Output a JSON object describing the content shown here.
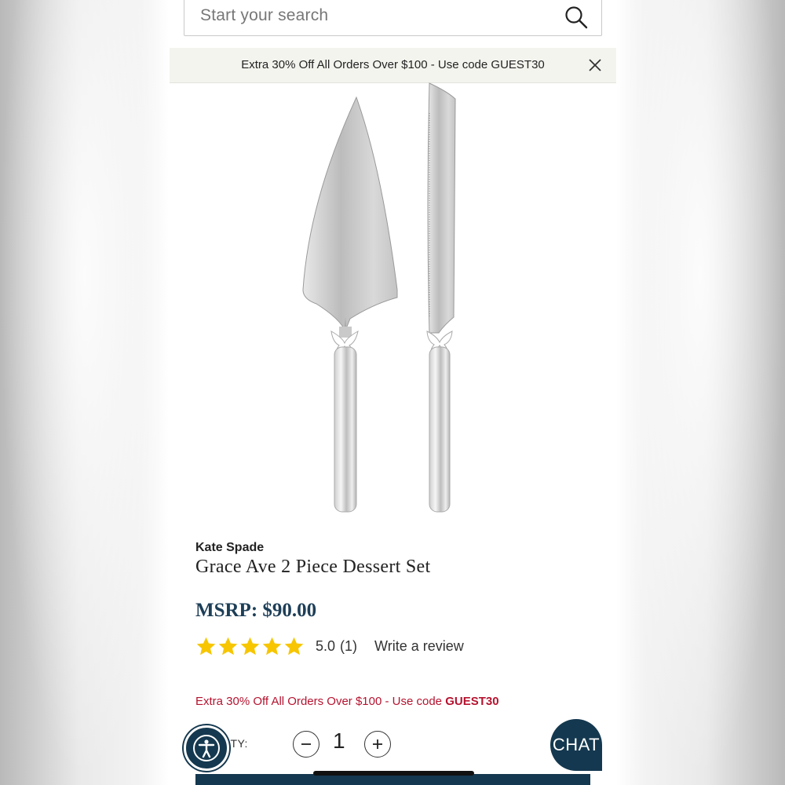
{
  "search": {
    "placeholder": "Start your search",
    "icon": "search-icon"
  },
  "promo_banner": {
    "text": "Extra 30% Off All Orders Over $100 - Use code GUEST30",
    "close_icon": "close-icon"
  },
  "product": {
    "brand": "Kate Spade",
    "title": "Grace Ave 2 Piece Dessert Set",
    "price": "MSRP: $90.00",
    "rating": {
      "value": "5.0",
      "count": "(1)",
      "stars": 5,
      "star_color": "#f7c600"
    },
    "write_review": "Write a review",
    "promo": {
      "prefix": "Extra 30% Off All Orders Over $100 - Use code ",
      "code": "GUEST30",
      "color": "#b5132f"
    }
  },
  "quantity": {
    "label": "TITY:",
    "value": "1"
  },
  "chat": {
    "label": "CHAT"
  },
  "colors": {
    "brand_navy": "#14384f",
    "price_navy": "#1d3e57",
    "banner_bg": "#f4f4ef"
  }
}
